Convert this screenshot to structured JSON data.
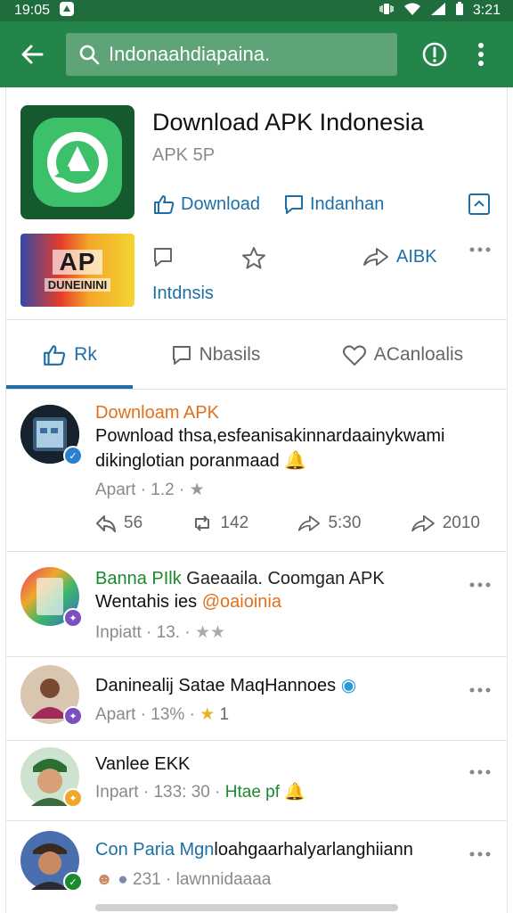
{
  "status_bar": {
    "time": "19:05",
    "clock_right": "3:21"
  },
  "search": {
    "query": "Indonaahdiapaina."
  },
  "app": {
    "title": "Download APK Indonesia",
    "subtitle": "APK 5P",
    "actions": [
      {
        "label": "Download",
        "icon": "thumbs-up-icon"
      },
      {
        "label": "Indanhan",
        "icon": "comment-icon"
      }
    ]
  },
  "row2": {
    "thumb_big": "AP",
    "thumb_small": "DUNEININI",
    "share_label": "AIBK",
    "label": "Intdnsis"
  },
  "tabs": [
    {
      "label": "Rk",
      "icon": "thumbs-up-icon",
      "active": true
    },
    {
      "label": "Nbasils",
      "icon": "comment-icon",
      "active": false
    },
    {
      "label": "ACanloalis",
      "icon": "heart-icon",
      "active": false
    }
  ],
  "posts": [
    {
      "name": "Downloam APK",
      "name_color": "#e0701a",
      "body_line1": "Pownload thsa,esfeanisakinnardaainykwami",
      "body_line2": "dikinglotian poranmaad",
      "meta": "Apart · 1.2 ·",
      "stats": [
        "56",
        "142",
        "5:30",
        "2010"
      ]
    },
    {
      "name": "Banna PIlk",
      "name_color": "#1a8a2e",
      "name_rest": "Gaeaaila. Coomgan APK",
      "body_line1": "Wentahis ies",
      "mention": "@oaioinia",
      "meta": "Inpiatt · 13. ·"
    },
    {
      "name": "Daninealij Satae MaqHannoes",
      "meta": "Apart · 13% ·",
      "meta_rating": "1"
    },
    {
      "name": "Vanlee EKK",
      "meta": "Inpart · 133: 30 ·",
      "meta_green": "Htae pf"
    },
    {
      "name": "Con Paria Mgn",
      "name_color": "#1d6fa5",
      "name_rest": "loahgaarhalyarlanghiiann",
      "meta": "231 · lawnnidaaaa"
    }
  ],
  "colors": {
    "app_bar": "#23854a",
    "status_bar": "#1f6d3c",
    "accent_blue": "#1d6fa5",
    "orange": "#e0701a",
    "green": "#1a8a2e"
  }
}
